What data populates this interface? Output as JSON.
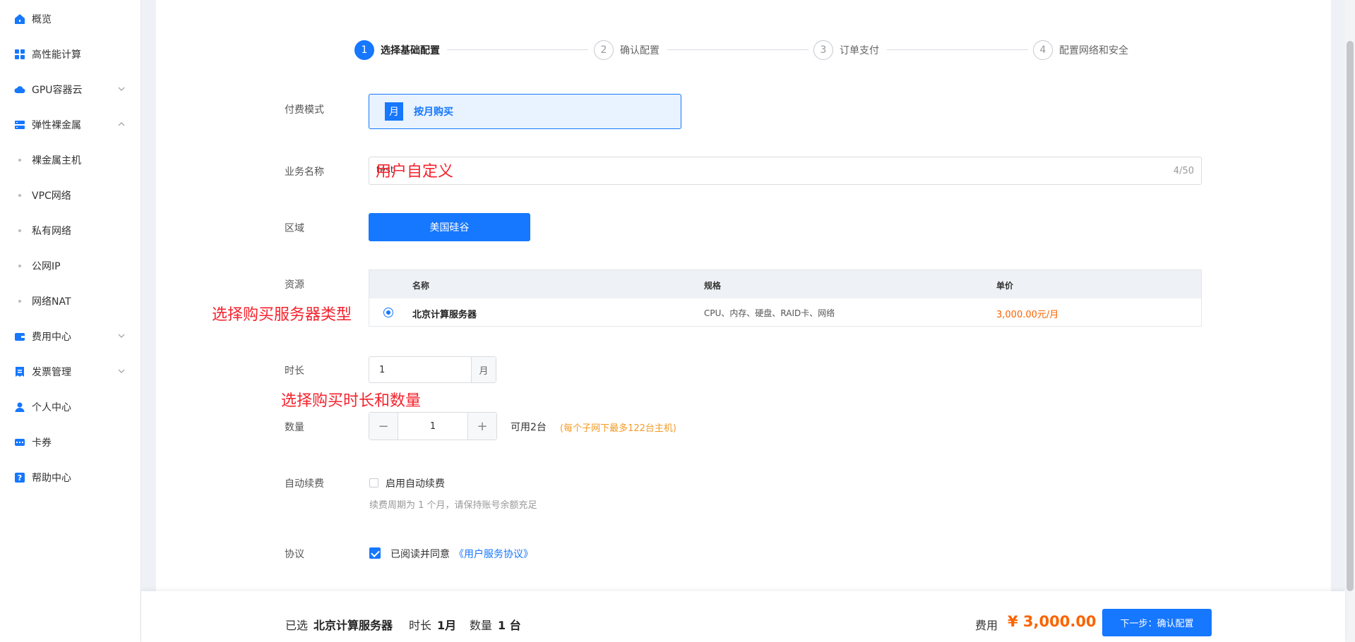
{
  "sidebar": {
    "items": [
      {
        "label": "概览",
        "icon": "home-icon"
      },
      {
        "label": "高性能计算",
        "icon": "grid-icon"
      },
      {
        "label": "GPU容器云",
        "icon": "cloud-icon"
      },
      {
        "label": "弹性裸金属",
        "icon": "server-icon"
      },
      {
        "label": "裸金属主机"
      },
      {
        "label": "VPC网络"
      },
      {
        "label": "私有网络"
      },
      {
        "label": "公网IP"
      },
      {
        "label": "网络NAT"
      },
      {
        "label": "费用中心",
        "icon": "wallet-icon"
      },
      {
        "label": "发票管理",
        "icon": "invoice-icon"
      },
      {
        "label": "个人中心",
        "icon": "user-icon"
      },
      {
        "label": "卡券",
        "icon": "coupon-icon"
      },
      {
        "label": "帮助中心",
        "icon": "help-icon"
      }
    ]
  },
  "steps": [
    {
      "num": "1",
      "label": "选择基础配置"
    },
    {
      "num": "2",
      "label": "确认配置"
    },
    {
      "num": "3",
      "label": "订单支付"
    },
    {
      "num": "4",
      "label": "配置网络和安全"
    }
  ],
  "form": {
    "pay_mode_label": "付费模式",
    "pay_mode_badge": "月",
    "pay_mode_value": "按月购买",
    "biz_name_label": "业务名称",
    "biz_name_value": "test",
    "biz_name_count": "4/50",
    "region_label": "区域",
    "region_value": "美国硅谷",
    "resource_label": "资源",
    "table_headers": {
      "name": "名称",
      "spec": "规格",
      "price": "单价"
    },
    "table_row": {
      "name": "北京计算服务器",
      "spec": "CPU、内存、硬盘、RAID卡、网络",
      "price": "3,000.00元/月"
    },
    "duration_label": "时长",
    "duration_value": "1",
    "duration_unit": "月",
    "qty_label": "数量",
    "qty_minus": "−",
    "qty_value": "1",
    "qty_plus": "+",
    "available": "可用2台",
    "subnet_note": "(每个子网下最多122台主机)",
    "auto_renew_label": "自动续费",
    "auto_renew_text": "启用自动续费",
    "auto_renew_hint": "续费周期为 1 个月，请保持账号余额充足",
    "agreement_label": "协议",
    "agreement_text": "已阅读并同意",
    "agreement_link": "《用户服务协议》"
  },
  "annotations": {
    "custom": "用户自定义",
    "server_type": "选择购买服务器类型",
    "duration_qty": "选择购买时长和数量"
  },
  "bottom": {
    "selected_prefix": "已选",
    "selected_value": "北京计算服务器",
    "duration_prefix": "时长",
    "duration_value": "1月",
    "qty_prefix": "数量",
    "qty_value": "1 台",
    "fee_label": "费用",
    "fee_value": "¥ 3,000.00",
    "next_button": "下一步：确认配置"
  },
  "colors": {
    "primary": "#1677ff",
    "price": "#fa6400",
    "annotation": "#f5222d",
    "note": "#f59a23"
  }
}
